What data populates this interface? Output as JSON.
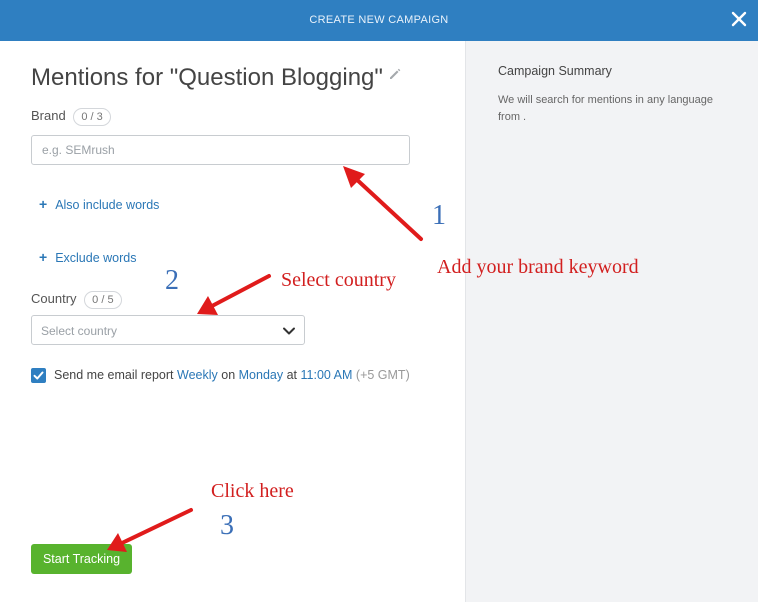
{
  "header": {
    "title": "CREATE NEW CAMPAIGN",
    "close_icon": "close-icon"
  },
  "form": {
    "campaign_title": "Mentions for \"Question Blogging\"",
    "brand": {
      "label": "Brand",
      "count": "0 / 3",
      "placeholder": "e.g. SEMrush"
    },
    "also_include": {
      "plus": "+",
      "label": "Also include words"
    },
    "exclude": {
      "plus": "+",
      "label": "Exclude words"
    },
    "country": {
      "label": "Country",
      "count": "0 / 5",
      "placeholder": "Select country"
    },
    "email": {
      "checked": true,
      "prefix": "Send me email report",
      "frequency": "Weekly",
      "on": "on",
      "day": "Monday",
      "at": "at",
      "time": "11:00 AM",
      "tz": "(+5 GMT)"
    },
    "start_button": "Start Tracking"
  },
  "summary": {
    "title": "Campaign Summary",
    "text": "We will search for mentions in any language from ."
  },
  "annotations": {
    "brand_note": "Add your brand keyword",
    "brand_num": "1",
    "country_note": "Select country",
    "country_num": "2",
    "click_note": "Click here",
    "click_num": "3",
    "arrow_color": "#e01b1b"
  },
  "colors": {
    "header_bg": "#2f7fc1",
    "accent_blue": "#2a77b6",
    "start_green": "#58b32e",
    "summary_bg": "#f2f3f5"
  }
}
